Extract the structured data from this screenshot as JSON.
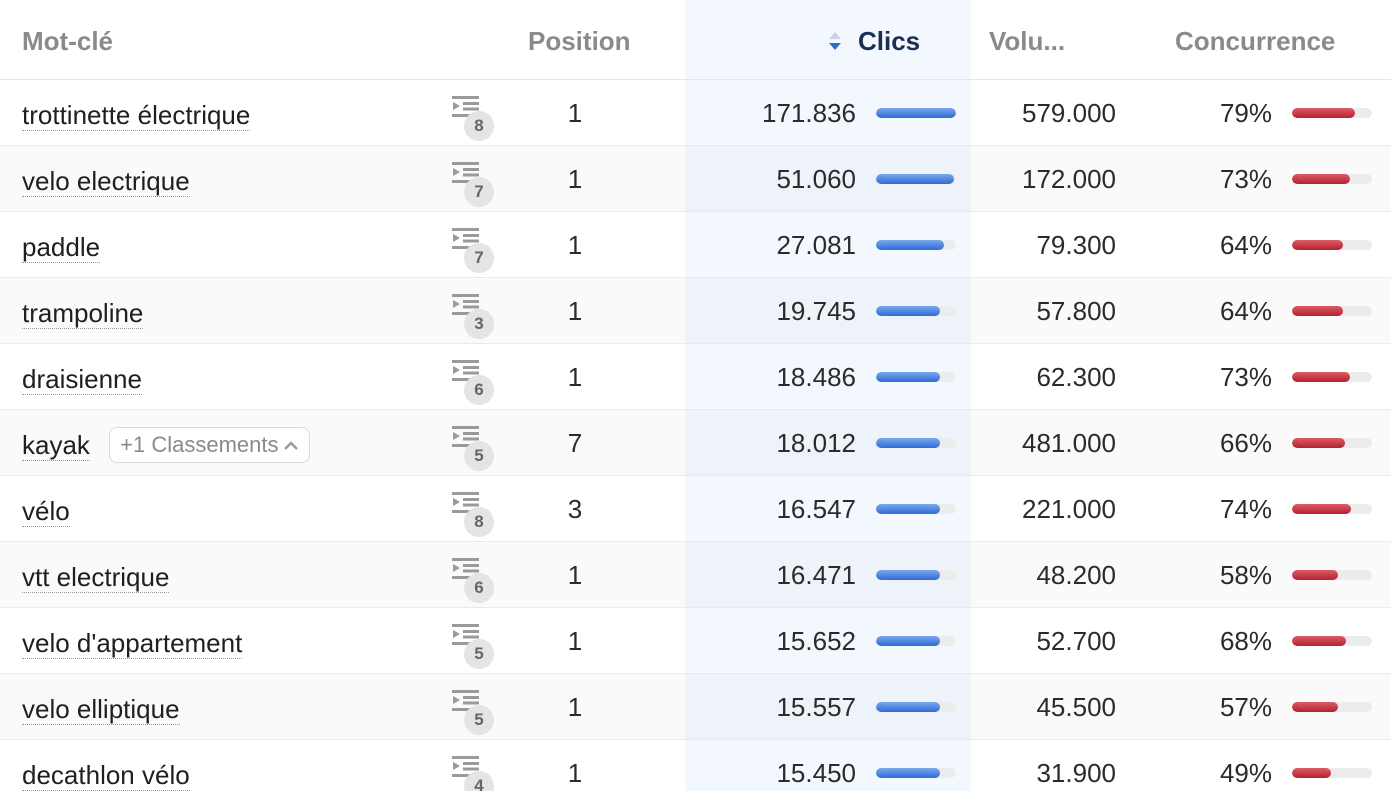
{
  "headers": {
    "keyword": "Mot-clé",
    "position": "Position",
    "clics": "Clics",
    "volume": "Volu...",
    "competition": "Concurrence"
  },
  "colors": {
    "clics_bar": "#2f6bd4",
    "competition_bar": "#b42232",
    "clics_column_bg": "#f3f7fe",
    "sorted_header": "#1b2f55"
  },
  "icons": {
    "sort": "sort-desc-icon",
    "serp": "serp-list-icon",
    "expand": "chevron-up-icon"
  },
  "rows": [
    {
      "keyword": "trottinette électrique",
      "serp_count": "8",
      "position": "1",
      "clics": "171.836",
      "clics_fill": 1.0,
      "volume": "579.000",
      "competition": "79%",
      "competition_fill": 0.79
    },
    {
      "keyword": "velo electrique",
      "serp_count": "7",
      "position": "1",
      "clics": "51.060",
      "clics_fill": 0.97,
      "volume": "172.000",
      "competition": "73%",
      "competition_fill": 0.73
    },
    {
      "keyword": "paddle",
      "serp_count": "7",
      "position": "1",
      "clics": "27.081",
      "clics_fill": 0.85,
      "volume": "79.300",
      "competition": "64%",
      "competition_fill": 0.64
    },
    {
      "keyword": "trampoline",
      "serp_count": "3",
      "position": "1",
      "clics": "19.745",
      "clics_fill": 0.8,
      "volume": "57.800",
      "competition": "64%",
      "competition_fill": 0.64
    },
    {
      "keyword": "draisienne",
      "serp_count": "6",
      "position": "1",
      "clics": "18.486",
      "clics_fill": 0.8,
      "volume": "62.300",
      "competition": "73%",
      "competition_fill": 0.73
    },
    {
      "keyword": "kayak",
      "serp_count": "5",
      "position": "7",
      "clics": "18.012",
      "clics_fill": 0.8,
      "volume": "481.000",
      "competition": "66%",
      "competition_fill": 0.66,
      "extra": "+1 Classements"
    },
    {
      "keyword": "vélo",
      "serp_count": "8",
      "position": "3",
      "clics": "16.547",
      "clics_fill": 0.8,
      "volume": "221.000",
      "competition": "74%",
      "competition_fill": 0.74
    },
    {
      "keyword": "vtt electrique",
      "serp_count": "6",
      "position": "1",
      "clics": "16.471",
      "clics_fill": 0.8,
      "volume": "48.200",
      "competition": "58%",
      "competition_fill": 0.58
    },
    {
      "keyword": "velo d'appartement",
      "serp_count": "5",
      "position": "1",
      "clics": "15.652",
      "clics_fill": 0.8,
      "volume": "52.700",
      "competition": "68%",
      "competition_fill": 0.68
    },
    {
      "keyword": "velo elliptique",
      "serp_count": "5",
      "position": "1",
      "clics": "15.557",
      "clics_fill": 0.8,
      "volume": "45.500",
      "competition": "57%",
      "competition_fill": 0.57
    },
    {
      "keyword": "decathlon vélo",
      "serp_count": "4",
      "position": "1",
      "clics": "15.450",
      "clics_fill": 0.8,
      "volume": "31.900",
      "competition": "49%",
      "competition_fill": 0.49
    }
  ]
}
